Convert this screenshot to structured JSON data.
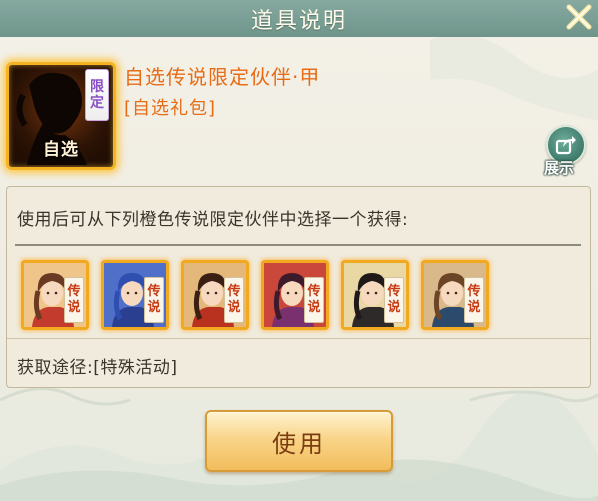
{
  "window": {
    "title": "道具说明"
  },
  "item": {
    "name": "自选传说限定伙伴·甲",
    "type": "[自选礼包]",
    "limited_tag": [
      "限",
      "定"
    ],
    "selectable_label": "自选"
  },
  "show_button": {
    "label": "展示"
  },
  "description": {
    "text": "使用后可从下列橙色传说限定伙伴中选择一个获得:",
    "partners": [
      {
        "name": "partner-1",
        "tag": [
          "传",
          "说"
        ],
        "palette": {
          "bg": "#f0c58a",
          "hair": "#6b3a22",
          "cloth": "#c23b2c"
        }
      },
      {
        "name": "partner-2",
        "tag": [
          "传",
          "说"
        ],
        "palette": {
          "bg": "#4f6fc9",
          "hair": "#2f4fb0",
          "cloth": "#2a3f8f"
        }
      },
      {
        "name": "partner-3",
        "tag": [
          "传",
          "说"
        ],
        "palette": {
          "bg": "#e4b77a",
          "hair": "#3a1f12",
          "cloth": "#b8321f"
        }
      },
      {
        "name": "partner-4",
        "tag": [
          "传",
          "说"
        ],
        "palette": {
          "bg": "#c9473b",
          "hair": "#3d1b2a",
          "cloth": "#7a2f6e"
        }
      },
      {
        "name": "partner-5",
        "tag": [
          "传",
          "说"
        ],
        "palette": {
          "bg": "#e9d7a4",
          "hair": "#1f1a18",
          "cloth": "#2e2a2a"
        }
      },
      {
        "name": "partner-6",
        "tag": [
          "传",
          "说"
        ],
        "palette": {
          "bg": "#d9b88a",
          "hair": "#6b4526",
          "cloth": "#2c4a6b"
        }
      }
    ],
    "source": "获取途径:[特殊活动]"
  },
  "use_button": {
    "label": "使用"
  },
  "colors": {
    "title_bar": "#7a9f95",
    "item_name": "#e86c16",
    "frame_gold": "#f3b322",
    "button_text": "#7b3c12"
  }
}
